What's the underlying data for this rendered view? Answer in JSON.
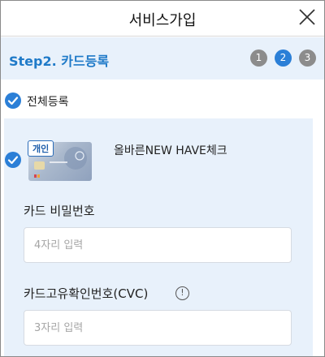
{
  "header": {
    "title": "서비스가입",
    "close_icon": "close-icon"
  },
  "step": {
    "title": "Step2. 카드등록",
    "steps": [
      "1",
      "2",
      "3"
    ],
    "current": 2
  },
  "select_all": {
    "label": "전체등록",
    "checked": true
  },
  "card": {
    "badge": "개인",
    "name": "올바른NEW HAVE체크",
    "checked": true
  },
  "fields": {
    "password": {
      "label": "카드 비밀번호",
      "placeholder": "4자리 입력",
      "value": ""
    },
    "cvc": {
      "label": "카드고유확인번호(CVC)",
      "placeholder": "3자리 입력",
      "value": "",
      "info_icon": "info-icon"
    }
  },
  "colors": {
    "accent": "#2b7fd7",
    "step_bg": "#e8f1fb",
    "title_blue": "#1f7ac8"
  }
}
